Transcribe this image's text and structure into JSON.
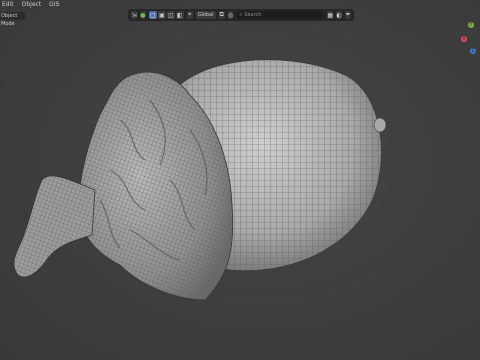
{
  "menu": {
    "items": [
      "Edit",
      "Object",
      "GIS"
    ]
  },
  "mode_selector": {
    "label": "Object Mode"
  },
  "header": {
    "transform_orientation": "Global",
    "search_placeholder": "Search",
    "icons": [
      "view-icon",
      "snap-icon",
      "proportional-icon",
      "filter-icon"
    ]
  },
  "gizmo": {
    "axes": [
      "Y",
      "X",
      "Z"
    ],
    "colors": [
      "#7fb23a",
      "#e04a5a",
      "#3a7bd5"
    ]
  },
  "viewport": {
    "background": "#3d3d3d",
    "object": "acorn-mesh"
  }
}
